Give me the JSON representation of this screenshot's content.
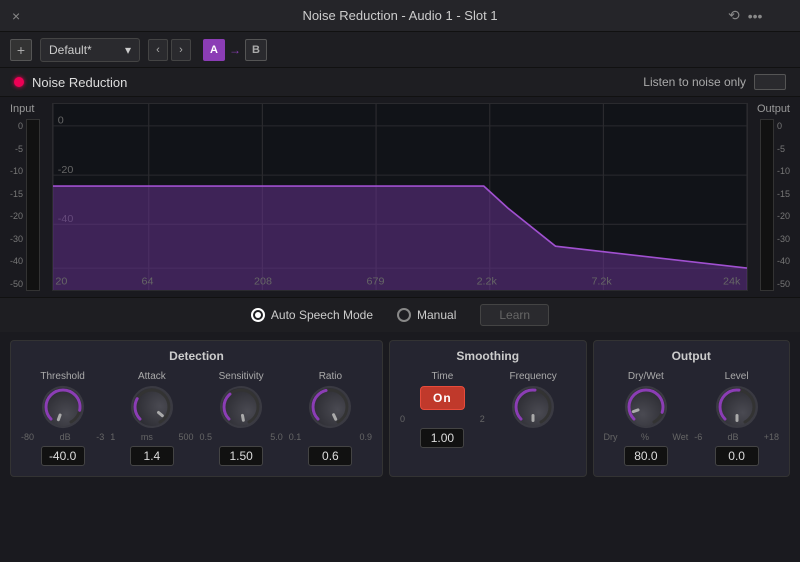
{
  "titleBar": {
    "title": "Noise Reduction - Audio 1 - Slot 1",
    "closeIcon": "×",
    "historyIcon": "⟲",
    "menuIcon": "···"
  },
  "toolbar": {
    "addLabel": "+",
    "preset": "Default*",
    "chevronDown": "▾",
    "prevLabel": "‹",
    "nextLabel": "›",
    "aLabel": "A",
    "arrowLabel": "→",
    "bLabel": "B"
  },
  "pluginHeader": {
    "pluginName": "Noise Reduction",
    "listenLabel": "Listen to noise only"
  },
  "vuMeter": {
    "inputLabel": "Input",
    "outputLabel": "Output",
    "ticks": [
      "0",
      "-5",
      "-10",
      "-15",
      "-20",
      "-30",
      "-40",
      "-50"
    ]
  },
  "spectrum": {
    "dbLabels": [
      "0",
      "-20",
      "-40"
    ],
    "freqLabels": [
      "20",
      "64",
      "208",
      "679",
      "2.2k",
      "7.2k",
      "24k"
    ]
  },
  "modeRow": {
    "autoSpeechLabel": "Auto Speech Mode",
    "manualLabel": "Manual",
    "learnLabel": "Learn"
  },
  "detection": {
    "title": "Detection",
    "threshold": {
      "label": "Threshold",
      "min": "-80",
      "max": "-3",
      "unit": "dB",
      "value": "-40.0",
      "angle": 200
    },
    "attack": {
      "label": "Attack",
      "min": "1",
      "max": "500",
      "unit": "ms",
      "value": "1.4",
      "angle": 130
    },
    "sensitivity": {
      "label": "Sensitivity",
      "min": "0.5",
      "max": "5.0",
      "value": "1.50",
      "angle": 170
    },
    "ratio": {
      "label": "Ratio",
      "min": "0.1",
      "max": "0.9",
      "value": "0.6",
      "angle": 155
    }
  },
  "smoothing": {
    "title": "Smoothing",
    "frequency": {
      "label": "Frequency",
      "value": "1.00",
      "angle": 180
    },
    "time": {
      "label": "Time",
      "min": "0",
      "max": "2",
      "onLabel": "On"
    }
  },
  "output": {
    "title": "Output",
    "dryWet": {
      "label": "Dry/Wet",
      "min": "Dry",
      "mid": "%",
      "max": "Wet",
      "value": "80.0",
      "angle": 250
    },
    "level": {
      "label": "Level",
      "min": "-6",
      "mid": "dB",
      "max": "+18",
      "value": "0.0",
      "angle": 180
    }
  }
}
